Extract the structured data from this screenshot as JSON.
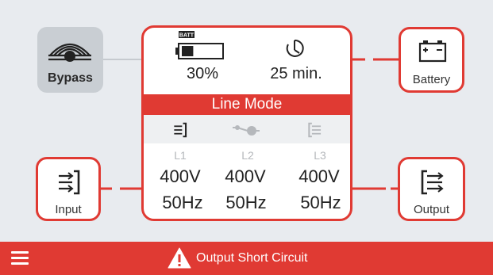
{
  "bypass": {
    "label": "Bypass",
    "icon": "bypass-wave-icon"
  },
  "battery": {
    "label": "Battery",
    "icon": "battery-terminal-icon"
  },
  "input": {
    "label": "Input",
    "icon": "input-arrows-icon"
  },
  "output": {
    "label": "Output",
    "icon": "output-arrows-icon"
  },
  "panel": {
    "battery_badge": "BATT",
    "battery_level": 0.3,
    "battery_percent": "30%",
    "runtime": "25 min.",
    "mode": "Line Mode",
    "mode_icons": [
      "input-arrows-icon",
      "bypass-switch-icon",
      "output-arrows-icon"
    ],
    "phases": [
      {
        "label": "L1",
        "voltage": "400V",
        "frequency": "50Hz"
      },
      {
        "label": "L2",
        "voltage": "400V",
        "frequency": "50Hz"
      },
      {
        "label": "L3",
        "voltage": "400V",
        "frequency": "50Hz"
      }
    ]
  },
  "status": {
    "message": "Output Short Circuit",
    "icon": "warning-triangle-icon"
  },
  "colors": {
    "accent": "#e03a33",
    "background": "#e8ebef",
    "bypass_tile": "#c9ced3",
    "inactive": "#b5b8bc"
  }
}
